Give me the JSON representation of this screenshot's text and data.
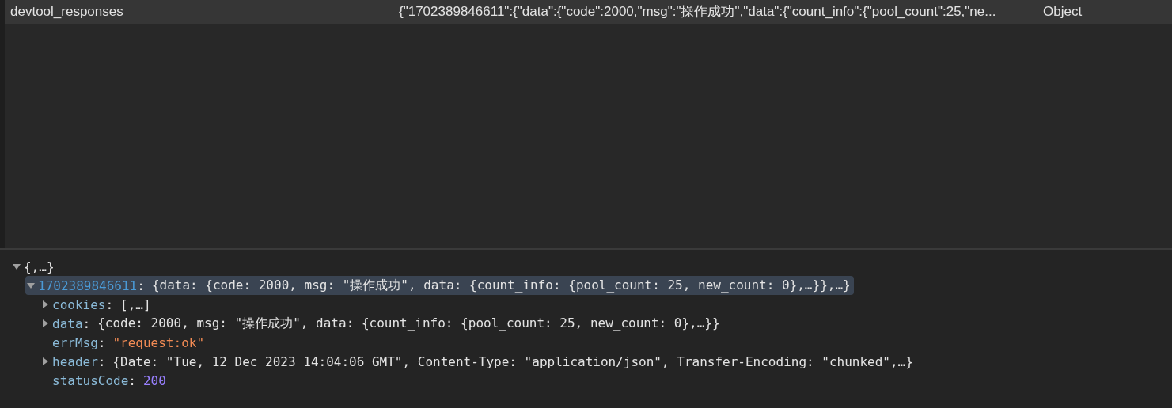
{
  "table": {
    "rows": [
      {
        "key": "devtool_responses",
        "value": "{\"1702389846611\":{\"data\":{\"code\":2000,\"msg\":\"操作成功\",\"data\":{\"count_info\":{\"pool_count\":25,\"ne...",
        "type": "Object",
        "selected": false
      }
    ]
  },
  "tree": {
    "label": "{,…}",
    "expanded": true,
    "children": [
      {
        "key": "1702389846611",
        "separator": ":",
        "value": "{data: {code: 2000, msg: \"操作成功\", data: {count_info: {pool_count: 25, new_count: 0},…}},…}",
        "kind": "object",
        "expanded": true,
        "selected": true,
        "children": [
          {
            "key": "cookies",
            "separator": ":",
            "value": "[,…]",
            "kind": "object",
            "expanded": false,
            "selected": false
          },
          {
            "key": "data",
            "separator": ":",
            "value": "{code: 2000, msg: \"操作成功\", data: {count_info: {pool_count: 25, new_count: 0},…}}",
            "kind": "object",
            "expanded": false,
            "selected": false
          },
          {
            "key": "errMsg",
            "separator": ":",
            "value": "\"request:ok\"",
            "kind": "string",
            "selected": false
          },
          {
            "key": "header",
            "separator": ":",
            "value": "{Date: \"Tue, 12 Dec 2023 14:04:06 GMT\", Content-Type: \"application/json\", Transfer-Encoding: \"chunked\",…}",
            "kind": "object",
            "expanded": false,
            "selected": false
          },
          {
            "key": "statusCode",
            "separator": ":",
            "value": "200",
            "kind": "number",
            "selected": false
          }
        ]
      }
    ]
  }
}
